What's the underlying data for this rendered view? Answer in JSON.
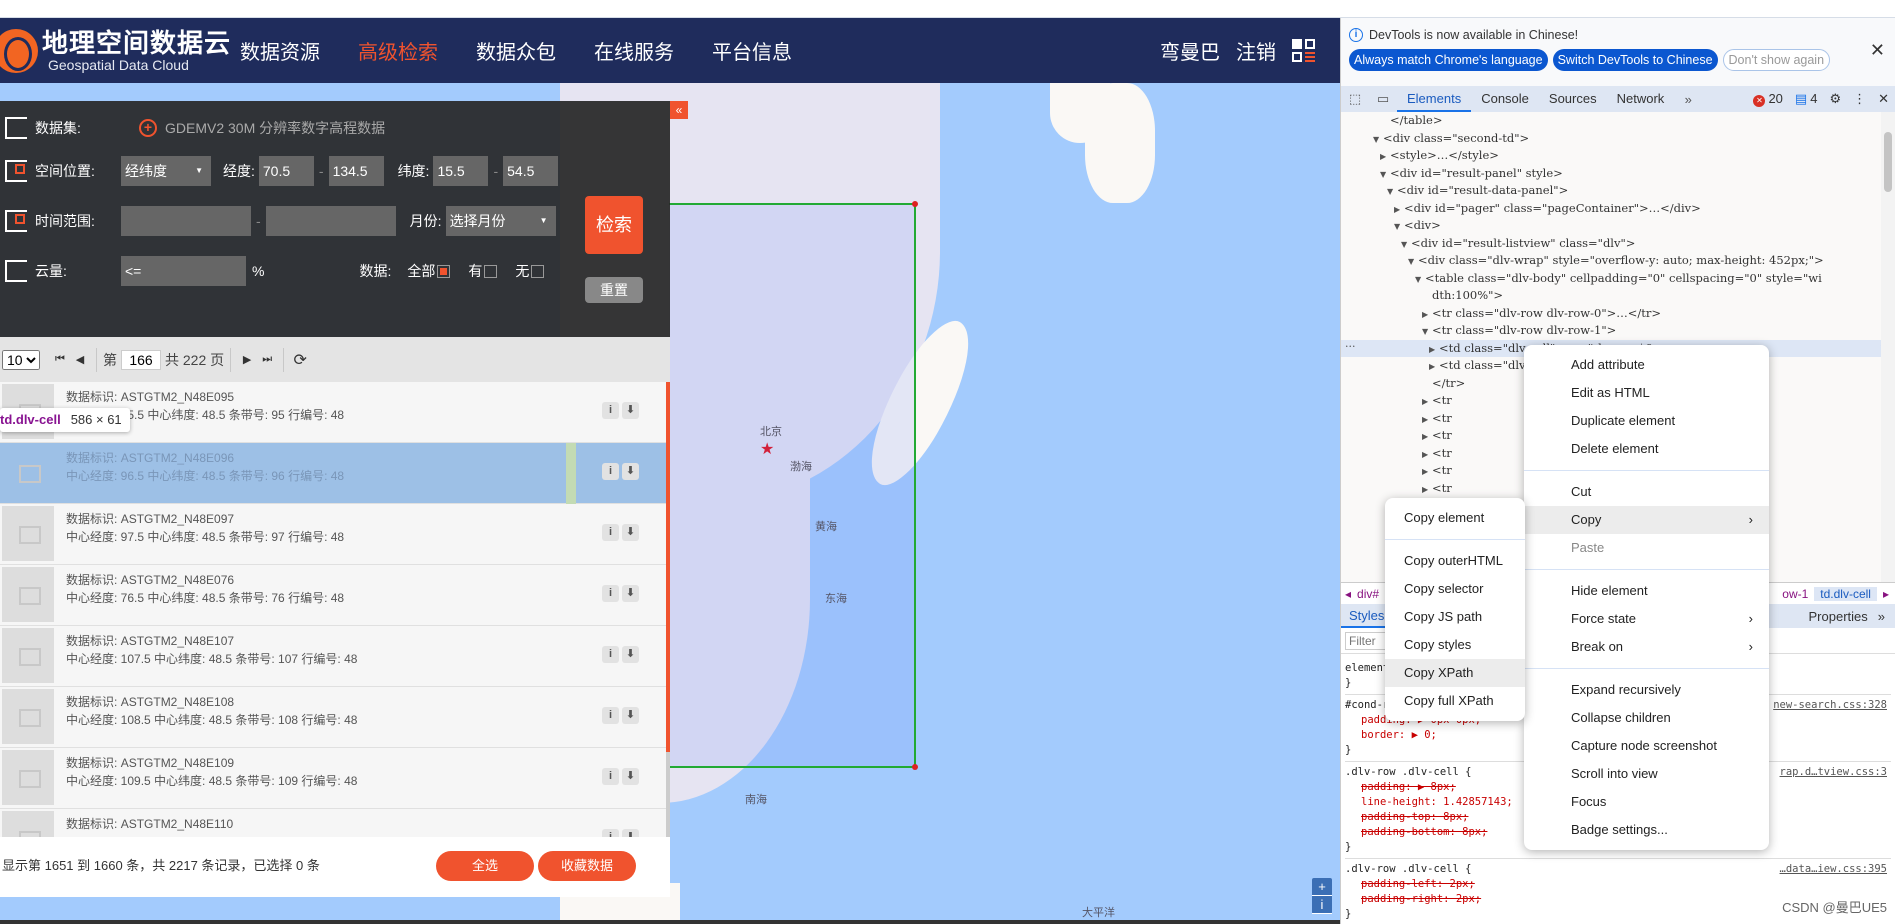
{
  "site": {
    "logo_cn": "地理空间数据云",
    "logo_en": "Geospatial Data Cloud",
    "nav": [
      {
        "label": "数据资源",
        "active": false
      },
      {
        "label": "高级检索",
        "active": true
      },
      {
        "label": "数据众包",
        "active": false
      },
      {
        "label": "在线服务",
        "active": false
      },
      {
        "label": "平台信息",
        "active": false
      }
    ],
    "user": "弯曼巴",
    "logout": "注销",
    "accent_color": "#f0532e",
    "nav_bg": "#1f2c5c"
  },
  "search": {
    "collapse_icon": "«",
    "dataset_label": "数据集:",
    "dataset_value": "GDEMV2 30M 分辨率数字高程数据",
    "space_label": "空间位置:",
    "space_mode": "经纬度",
    "lon_label": "经度:",
    "lon_min": "70.5",
    "lon_max": "134.5",
    "lat_label": "纬度:",
    "lat_min": "15.5",
    "lat_max": "54.5",
    "time_label": "时间范围:",
    "time_start": "",
    "time_end": "",
    "month_label": "月份:",
    "month_value": "选择月份",
    "cloud_label": "云量:",
    "cloud_value": "<=",
    "cloud_unit": "%",
    "data_label": "数据:",
    "data_options": [
      {
        "label": "全部",
        "checked": true
      },
      {
        "label": "有",
        "checked": false
      },
      {
        "label": "无",
        "checked": false
      }
    ],
    "dash": "-",
    "search_btn": "检索",
    "reset_btn": "重置"
  },
  "pager": {
    "page_size": "10",
    "page_prefix": "第",
    "current_page": "166",
    "total_label": "共 222 页"
  },
  "results": [
    {
      "id_label": "数据标识:",
      "id": "ASTGTM2_N48E095",
      "detail": "中心经度: 95.5 中心纬度: 48.5 条带号: 95 行编号: 48",
      "highlighted": false
    },
    {
      "id_label": "数据标识:",
      "id": "ASTGTM2_N48E096",
      "detail": "中心经度: 96.5 中心纬度: 48.5 条带号: 96 行编号: 48",
      "highlighted": true
    },
    {
      "id_label": "数据标识:",
      "id": "ASTGTM2_N48E097",
      "detail": "中心经度: 97.5 中心纬度: 48.5 条带号: 97 行编号: 48",
      "highlighted": false
    },
    {
      "id_label": "数据标识:",
      "id": "ASTGTM2_N48E076",
      "detail": "中心经度: 76.5 中心纬度: 48.5 条带号: 76 行编号: 48",
      "highlighted": false
    },
    {
      "id_label": "数据标识:",
      "id": "ASTGTM2_N48E107",
      "detail": "中心经度: 107.5 中心纬度: 48.5 条带号: 107 行编号: 48",
      "highlighted": false
    },
    {
      "id_label": "数据标识:",
      "id": "ASTGTM2_N48E108",
      "detail": "中心经度: 108.5 中心纬度: 48.5 条带号: 108 行编号: 48",
      "highlighted": false
    },
    {
      "id_label": "数据标识:",
      "id": "ASTGTM2_N48E109",
      "detail": "中心经度: 109.5 中心纬度: 48.5 条带号: 109 行编号: 48",
      "highlighted": false
    },
    {
      "id_label": "数据标识:",
      "id": "ASTGTM2_N48E110",
      "detail": "",
      "highlighted": false
    }
  ],
  "footer": {
    "info": "显示第 1651 到 1660 条，共 2217 条记录，已选择 0 条",
    "select_all": "全选",
    "favorite": "收藏数据"
  },
  "tooltip": {
    "selector": "td.dlv-cell",
    "size": "586 × 61"
  },
  "map": {
    "labels": [
      "北京",
      "渤海",
      "黄海",
      "东海",
      "南海",
      "大平洋"
    ],
    "zoom_in": "+",
    "info": "i"
  },
  "devtools": {
    "banner_msg": "DevTools is now available in Chinese!",
    "pill_match": "Always match Chrome's language",
    "pill_switch": "Switch DevTools to Chinese",
    "pill_dont": "Don't show again",
    "tabs": [
      "Elements",
      "Console",
      "Sources",
      "Network"
    ],
    "more_tabs": "»",
    "error_count": "20",
    "message_count": "4",
    "dom_lines": [
      {
        "indent": 5,
        "tri": "",
        "html": "</table>"
      },
      {
        "indent": 4,
        "tri": "▼",
        "html": "<div class=\"second-td\">"
      },
      {
        "indent": 5,
        "tri": "▶",
        "html": "<style>…</style>"
      },
      {
        "indent": 5,
        "tri": "▼",
        "html": "<div id=\"result-panel\" style>"
      },
      {
        "indent": 6,
        "tri": "▼",
        "html": "<div id=\"result-data-panel\">"
      },
      {
        "indent": 7,
        "tri": "▶",
        "html": "<div id=\"pager\" class=\"pageContainer\">…</div>"
      },
      {
        "indent": 7,
        "tri": "▼",
        "html": "<div>"
      },
      {
        "indent": 8,
        "tri": "▼",
        "html": "<div id=\"result-listview\" class=\"dlv\">"
      },
      {
        "indent": 9,
        "tri": "▼",
        "html": "<div class=\"dlv-wrap\" style=\"overflow-y: auto; max-height: 452px;\">"
      },
      {
        "indent": 10,
        "tri": "▼",
        "html": "<table class=\"dlv-body\" cellpadding=\"0\" cellspacing=\"0\" style=\"wi"
      },
      {
        "indent": 11,
        "tri": "",
        "html": "dth:100%\">"
      },
      {
        "indent": 11,
        "tri": "▶",
        "html": "<tr class=\"dlv-row dlv-row-0\">…</tr>"
      },
      {
        "indent": 11,
        "tri": "▼",
        "html": "<tr class=\"dlv-row dlv-row-1\">"
      },
      {
        "indent": 12,
        "tri": "▶",
        "html": "<td class=\"dlv-cell\">…</td> == $0"
      },
      {
        "indent": 12,
        "tri": "▶",
        "html": "<td class=\"dlv-cell\">…</td>"
      },
      {
        "indent": 11,
        "tri": "",
        "html": "</tr>"
      },
      {
        "indent": 11,
        "tri": "▶",
        "html": "<tr"
      },
      {
        "indent": 11,
        "tri": "▶",
        "html": "<tr"
      },
      {
        "indent": 11,
        "tri": "▶",
        "html": "<tr"
      },
      {
        "indent": 11,
        "tri": "▶",
        "html": "<tr"
      },
      {
        "indent": 11,
        "tri": "▶",
        "html": "<tr"
      },
      {
        "indent": 11,
        "tri": "▶",
        "html": "<tr"
      },
      {
        "indent": 11,
        "tri": "▶",
        "html": "<tr"
      }
    ],
    "breadcrumb_start": "div#",
    "breadcrumb_mid": "ow-1",
    "breadcrumb_end": "td.dlv-cell",
    "styles_tab": "Styles",
    "properties_tab": "Properties",
    "filter_placeholder": "Filter",
    "style_rules": [
      {
        "selector": "element.style {",
        "props": [],
        "source": ""
      },
      {
        "selector": "#cond-r… wrap .d… {",
        "props": [
          {
            "text": "padding: ▶ 0px 0px;",
            "strike": false
          },
          {
            "text": "border: ▶ 0;",
            "strike": false
          }
        ],
        "source": "new-search.css:328"
      },
      {
        "selector": ".dlv-row .dlv-cell {",
        "props": [
          {
            "text": "padding: ▶ 8px;",
            "strike": true
          },
          {
            "text": "line-height: 1.42857143;",
            "strike": false
          },
          {
            "text": "padding-top: 8px;",
            "strike": true
          },
          {
            "text": "padding-bottom: 8px;",
            "strike": true
          }
        ],
        "source": "rap.d…tview.css:3"
      },
      {
        "selector": ".dlv-row .dlv-cell {",
        "props": [
          {
            "text": "padding-left: 2px;",
            "strike": true
          },
          {
            "text": "padding-right: 2px;",
            "strike": true
          }
        ],
        "source": "…data…iew.css:395"
      }
    ]
  },
  "context_menu": {
    "items": [
      {
        "label": "Add attribute",
        "sep_after": false
      },
      {
        "label": "Edit as HTML",
        "sep_after": false
      },
      {
        "label": "Duplicate element",
        "sep_after": false
      },
      {
        "label": "Delete element",
        "sep_after": true
      },
      {
        "label": "Cut",
        "sep_after": false
      },
      {
        "label": "Copy",
        "submenu": true,
        "hover": true,
        "sep_after": false
      },
      {
        "label": "Paste",
        "disabled": true,
        "sep_after": true
      },
      {
        "label": "Hide element",
        "sep_after": false
      },
      {
        "label": "Force state",
        "submenu": true,
        "sep_after": false
      },
      {
        "label": "Break on",
        "submenu": true,
        "sep_after": true
      },
      {
        "label": "Expand recursively",
        "sep_after": false
      },
      {
        "label": "Collapse children",
        "sep_after": false
      },
      {
        "label": "Capture node screenshot",
        "sep_after": false
      },
      {
        "label": "Scroll into view",
        "sep_after": false
      },
      {
        "label": "Focus",
        "sep_after": false
      },
      {
        "label": "Badge settings...",
        "sep_after": false
      }
    ]
  },
  "copy_submenu": {
    "items": [
      {
        "label": "Copy element",
        "sep_after": true
      },
      {
        "label": "Copy outerHTML",
        "sep_after": false
      },
      {
        "label": "Copy selector",
        "sep_after": false
      },
      {
        "label": "Copy JS path",
        "sep_after": false
      },
      {
        "label": "Copy styles",
        "sep_after": false
      },
      {
        "label": "Copy XPath",
        "hover": true,
        "sep_after": false
      },
      {
        "label": "Copy full XPath",
        "sep_after": false
      }
    ]
  },
  "watermark": "CSDN @曼巴UE5"
}
